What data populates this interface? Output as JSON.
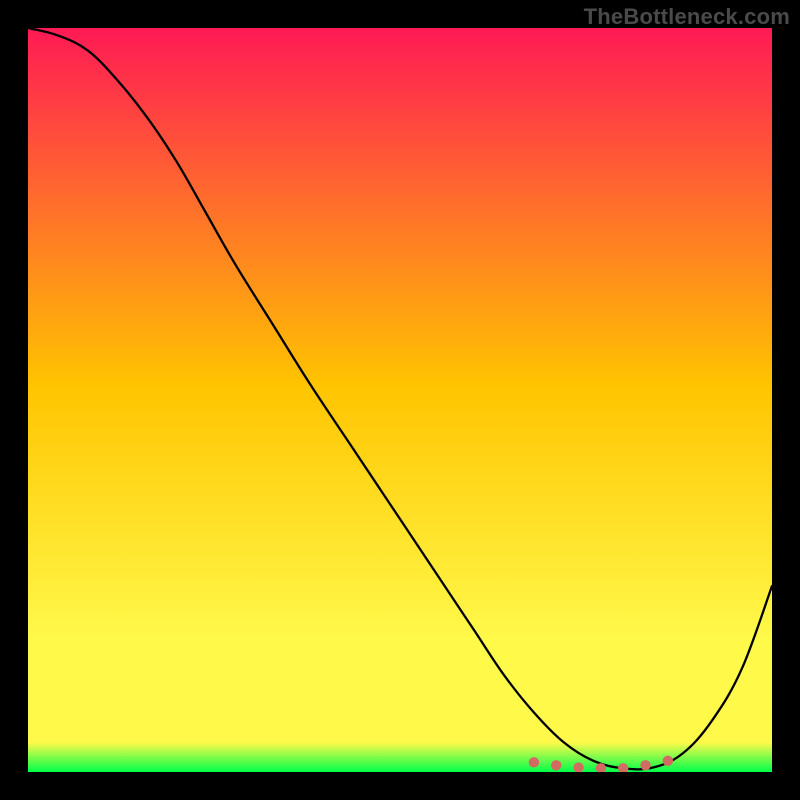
{
  "watermark": "TheBottleneck.com",
  "colors": {
    "frame": "#000000",
    "watermark": "#4a4a4a",
    "grad_top": "#ff1a55",
    "grad_mid": "#ffc400",
    "grad_low": "#fff94a",
    "grad_bottom": "#00ff4a",
    "curve": "#000000",
    "marker": "#d46b62"
  },
  "chart_data": {
    "type": "line",
    "title": "",
    "xlabel": "",
    "ylabel": "",
    "xlim": [
      0,
      100
    ],
    "ylim": [
      0,
      100
    ],
    "series": [
      {
        "name": "bottleneck-curve",
        "x": [
          0,
          4,
          8,
          12,
          16,
          20,
          24,
          28,
          33,
          38,
          44,
          50,
          56,
          60,
          64,
          68,
          72,
          76,
          80,
          84,
          88,
          92,
          96,
          100
        ],
        "values": [
          100,
          99,
          97,
          93,
          88,
          82,
          75,
          68,
          60,
          52,
          43,
          34,
          25,
          19,
          13,
          8,
          4,
          1.5,
          0.5,
          0.6,
          2.5,
          7,
          14,
          25
        ]
      }
    ],
    "annotations": [
      {
        "name": "optimal-marker",
        "x": 68,
        "y": 1.3
      },
      {
        "name": "optimal-marker",
        "x": 71,
        "y": 0.9
      },
      {
        "name": "optimal-marker",
        "x": 74,
        "y": 0.6
      },
      {
        "name": "optimal-marker",
        "x": 77,
        "y": 0.5
      },
      {
        "name": "optimal-marker",
        "x": 80,
        "y": 0.5
      },
      {
        "name": "optimal-marker",
        "x": 83,
        "y": 0.9
      },
      {
        "name": "optimal-marker",
        "x": 86,
        "y": 1.5
      }
    ]
  }
}
